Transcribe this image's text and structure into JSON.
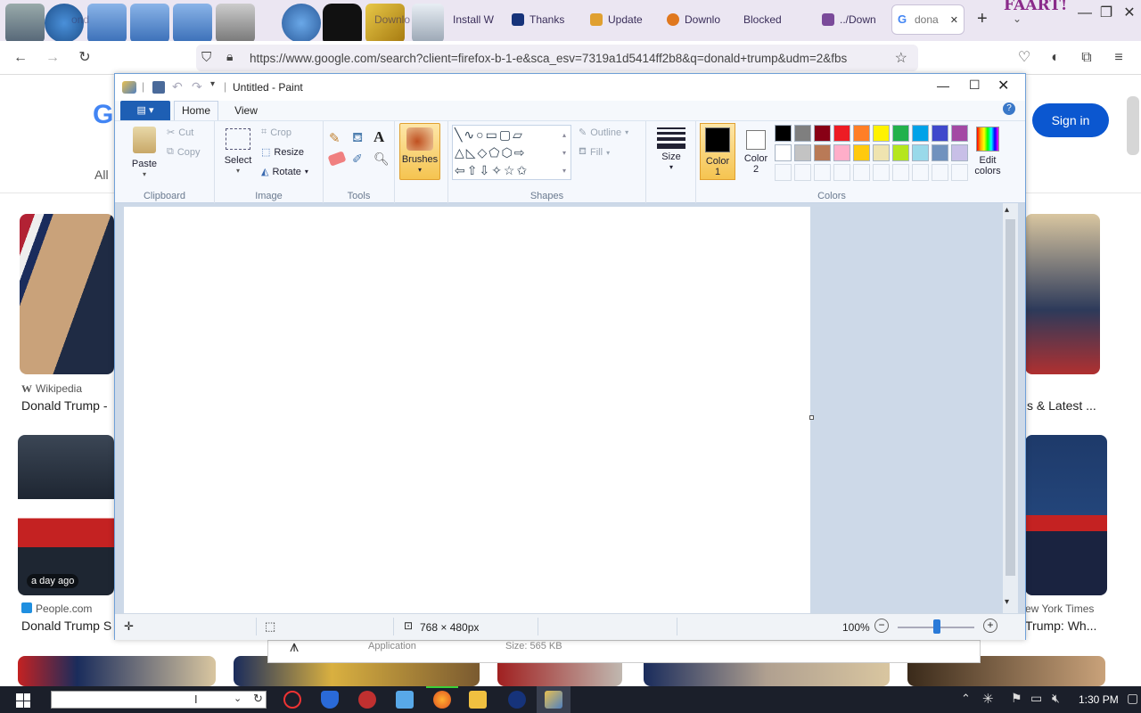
{
  "browser": {
    "tabs": [
      {
        "label": "ond",
        "favcolor": "#6c6c6c"
      },
      {
        "label": "Downlo",
        "favcolor": "#3b3b3b"
      },
      {
        "label": "Install W",
        "favcolor": "#e44"
      },
      {
        "label": "Thanks",
        "favcolor": "#16337a"
      },
      {
        "label": "Update",
        "favcolor": "#e0a030"
      },
      {
        "label": "Downlo",
        "favcolor": "#e0781e"
      },
      {
        "label": "Blocked",
        "favcolor": "#ffffff"
      },
      {
        "label": "../Down",
        "favcolor": "#7a4a9a"
      }
    ],
    "active_tab": {
      "label": "dona",
      "close": "✕"
    },
    "new_tab": "+",
    "corner_text": "FAART!",
    "url": "https://www.google.com/search?client=firefox-b-1-e&sca_esv=7319a1d5414ff2b8&q=donald+trump&udm=2&fbs"
  },
  "google": {
    "logo_letter": "G",
    "nav_all": "All",
    "sign_in": "Sign in",
    "results": [
      {
        "source": "Wikipedia",
        "source_icon": "W",
        "title": "Donald Trump -"
      },
      {
        "source": "",
        "title": "s & Latest ..."
      },
      {
        "badge": "a day ago",
        "source": "People.com",
        "title": "Donald Trump S"
      },
      {
        "source": "ew York Times",
        "title": "Trump: Wh..."
      }
    ],
    "bottom_panel": {
      "app_label": "Application",
      "size_label": "Size: 565 KB"
    }
  },
  "paint": {
    "title": "Untitled - Paint",
    "tabs": {
      "home": "Home",
      "view": "View"
    },
    "clipboard": {
      "paste": "Paste",
      "cut": "Cut",
      "copy": "Copy",
      "group": "Clipboard"
    },
    "image": {
      "select": "Select",
      "crop": "Crop",
      "resize": "Resize",
      "rotate": "Rotate",
      "group": "Image"
    },
    "tools": {
      "group": "Tools"
    },
    "brushes": "Brushes",
    "shapes": {
      "outline": "Outline",
      "fill": "Fill",
      "group": "Shapes"
    },
    "size": "Size",
    "color1": {
      "label": "Color",
      "num": "1",
      "value": "#000000"
    },
    "color2": {
      "label": "Color",
      "num": "2",
      "value": "#ffffff"
    },
    "colors_group": "Colors",
    "edit_colors": {
      "line1": "Edit",
      "line2": "colors"
    },
    "palette": [
      "#000000",
      "#7f7f7f",
      "#880015",
      "#ed1c24",
      "#ff7f27",
      "#fff200",
      "#22b14c",
      "#00a2e8",
      "#3f48cc",
      "#a349a4",
      "#ffffff",
      "#c3c3c3",
      "#b97a57",
      "#ffaec9",
      "#ffc90e",
      "#efe4b0",
      "#b5e61d",
      "#99d9ea",
      "#7092be",
      "#c8bfe7"
    ],
    "status": {
      "dimensions": "768 × 480px",
      "zoom": "100%"
    }
  },
  "taskbar": {
    "clock": "1:30 PM"
  }
}
